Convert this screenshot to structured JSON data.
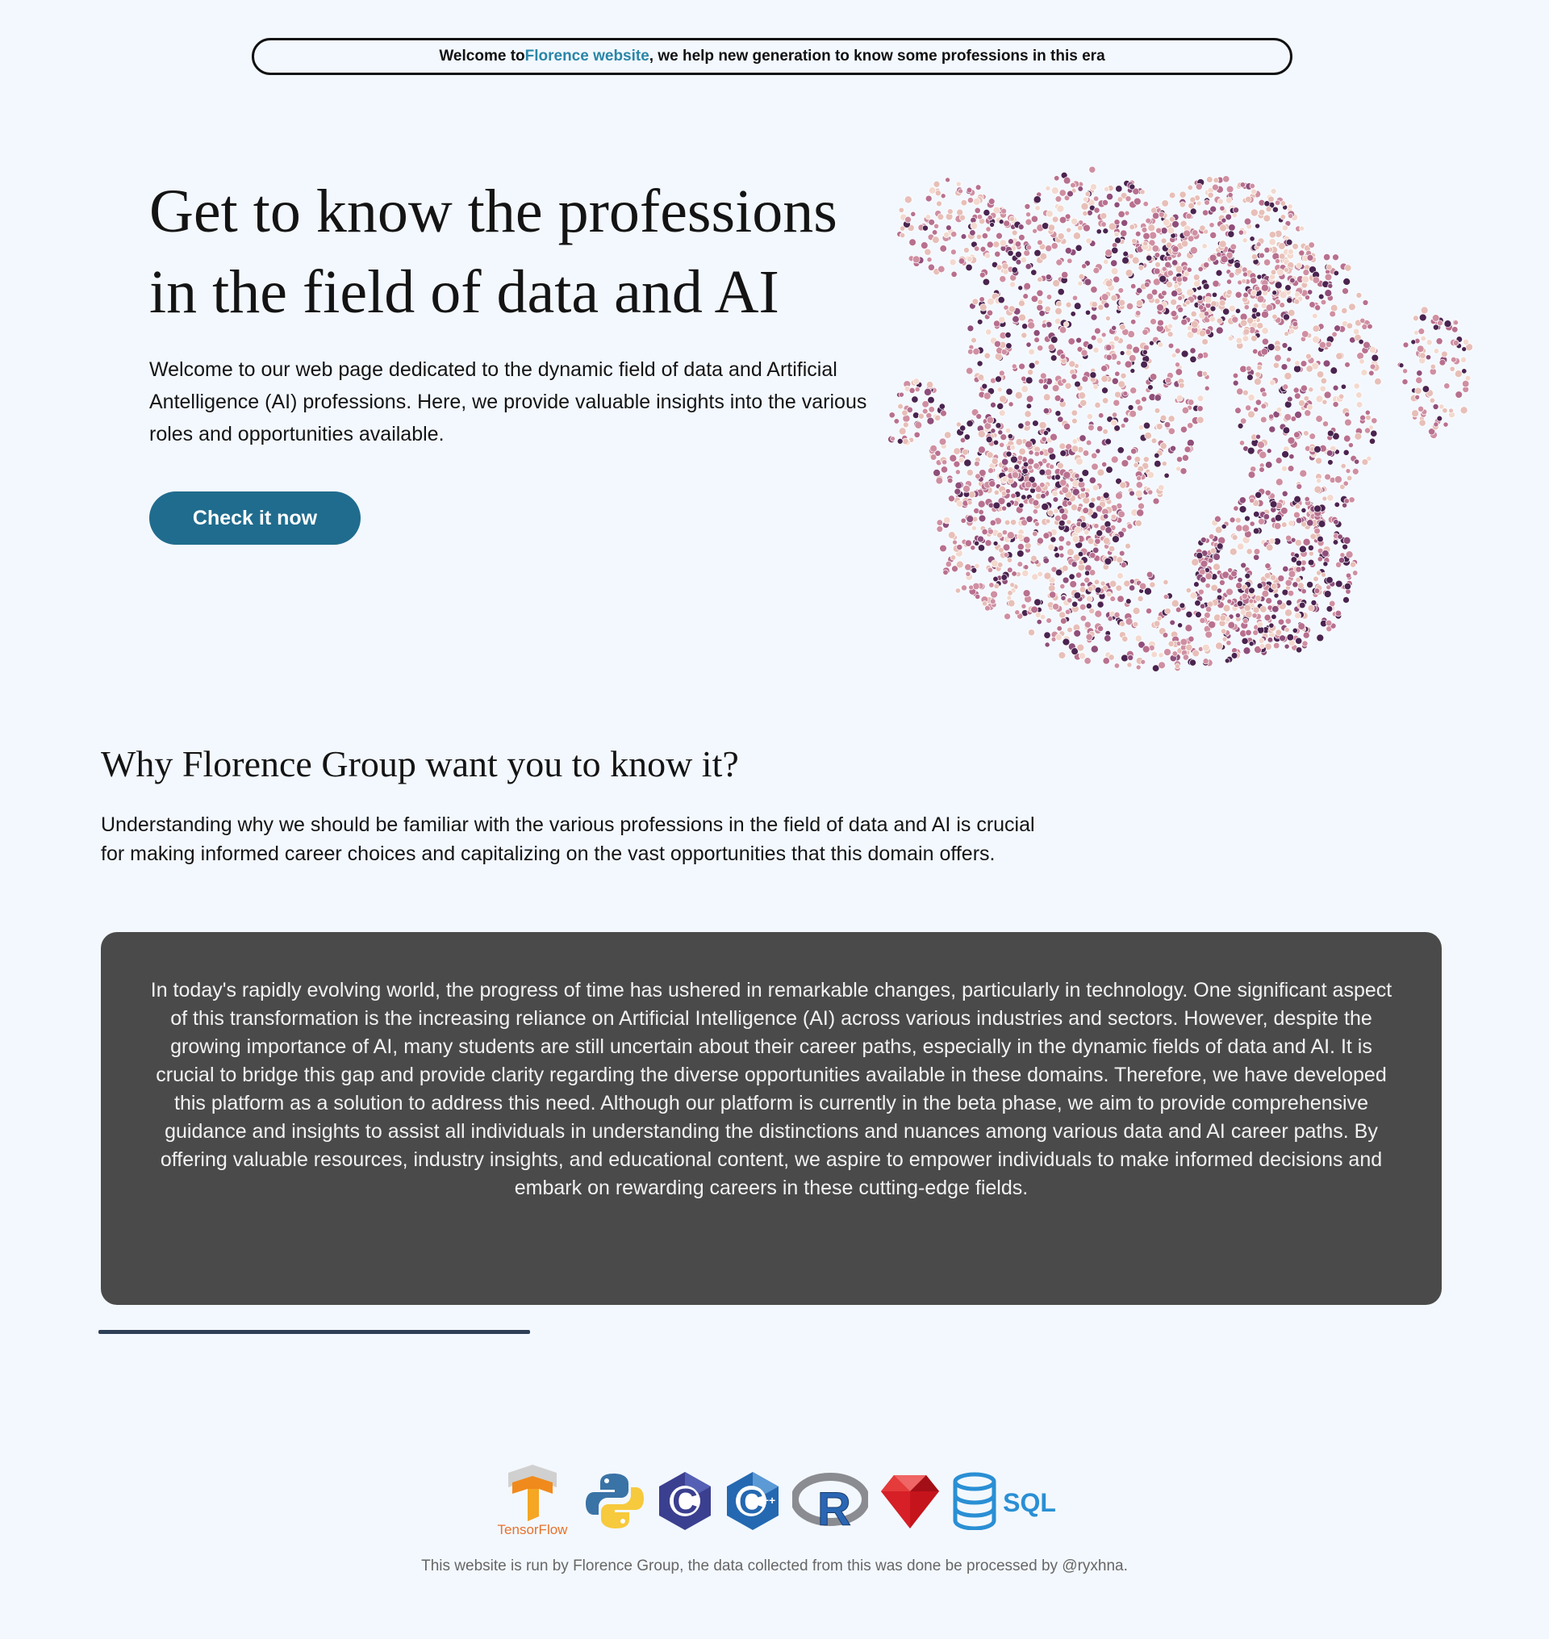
{
  "banner": {
    "prefix": "Welcome to ",
    "highlight": "Florence website",
    "suffix": ", we help new generation to know some professions in this era"
  },
  "hero": {
    "title_line1": "Get to know the professions",
    "title_line2": "in the field of data and AI",
    "text": "Welcome to our web page dedicated to the dynamic field of data and Artificial Antelligence (AI) professions. Here, we provide valuable insights into the various roles and opportunities available.",
    "cta_label": "Check it  now"
  },
  "colors": {
    "background": "#f3f8fe",
    "accent": "#206c8e",
    "link": "#2a86a8",
    "panel": "#4a4a4a",
    "scatter_palette": [
      "#f3d9cf",
      "#e7bfb8",
      "#cf8fa2",
      "#b8708f",
      "#8e4e7a",
      "#4a2450"
    ]
  },
  "why": {
    "title": "Why Florence Group want you to know it?",
    "text": "Understanding why we should be familiar with the various professions in the field of data and AI is crucial for making informed career choices and capitalizing on the vast opportunities that this domain offers."
  },
  "panel": {
    "text": "In today's rapidly evolving world, the progress of time has ushered in remarkable changes, particularly in technology. One significant aspect of this transformation is the increasing reliance on Artificial Intelligence (AI) across various industries and sectors. However, despite the growing importance of AI, many students are still uncertain about their career paths, especially in the dynamic fields of data and AI. It is crucial to bridge this gap and provide clarity regarding the diverse opportunities available in these domains. Therefore, we have developed this platform as a solution to address this need. Although our platform is currently in the beta phase, we aim to provide comprehensive guidance and insights to assist all individuals in understanding the distinctions and nuances among various data and AI career paths. By offering valuable resources, industry insights, and educational content, we aspire to empower individuals to make informed decisions and embark on rewarding careers in these cutting-edge fields."
  },
  "logos": [
    {
      "icon": "tensorflow-logo",
      "label": "TensorFlow"
    },
    {
      "icon": "python-logo"
    },
    {
      "icon": "c-logo",
      "label": "C"
    },
    {
      "icon": "cpp-logo",
      "label": "C"
    },
    {
      "icon": "r-logo",
      "label": "R"
    },
    {
      "icon": "ruby-logo"
    },
    {
      "icon": "sql-logo",
      "label": "SQL"
    }
  ],
  "footer": {
    "text": "This website is run by Florence Group, the data collected from this was done be processed by @ryxhna."
  }
}
